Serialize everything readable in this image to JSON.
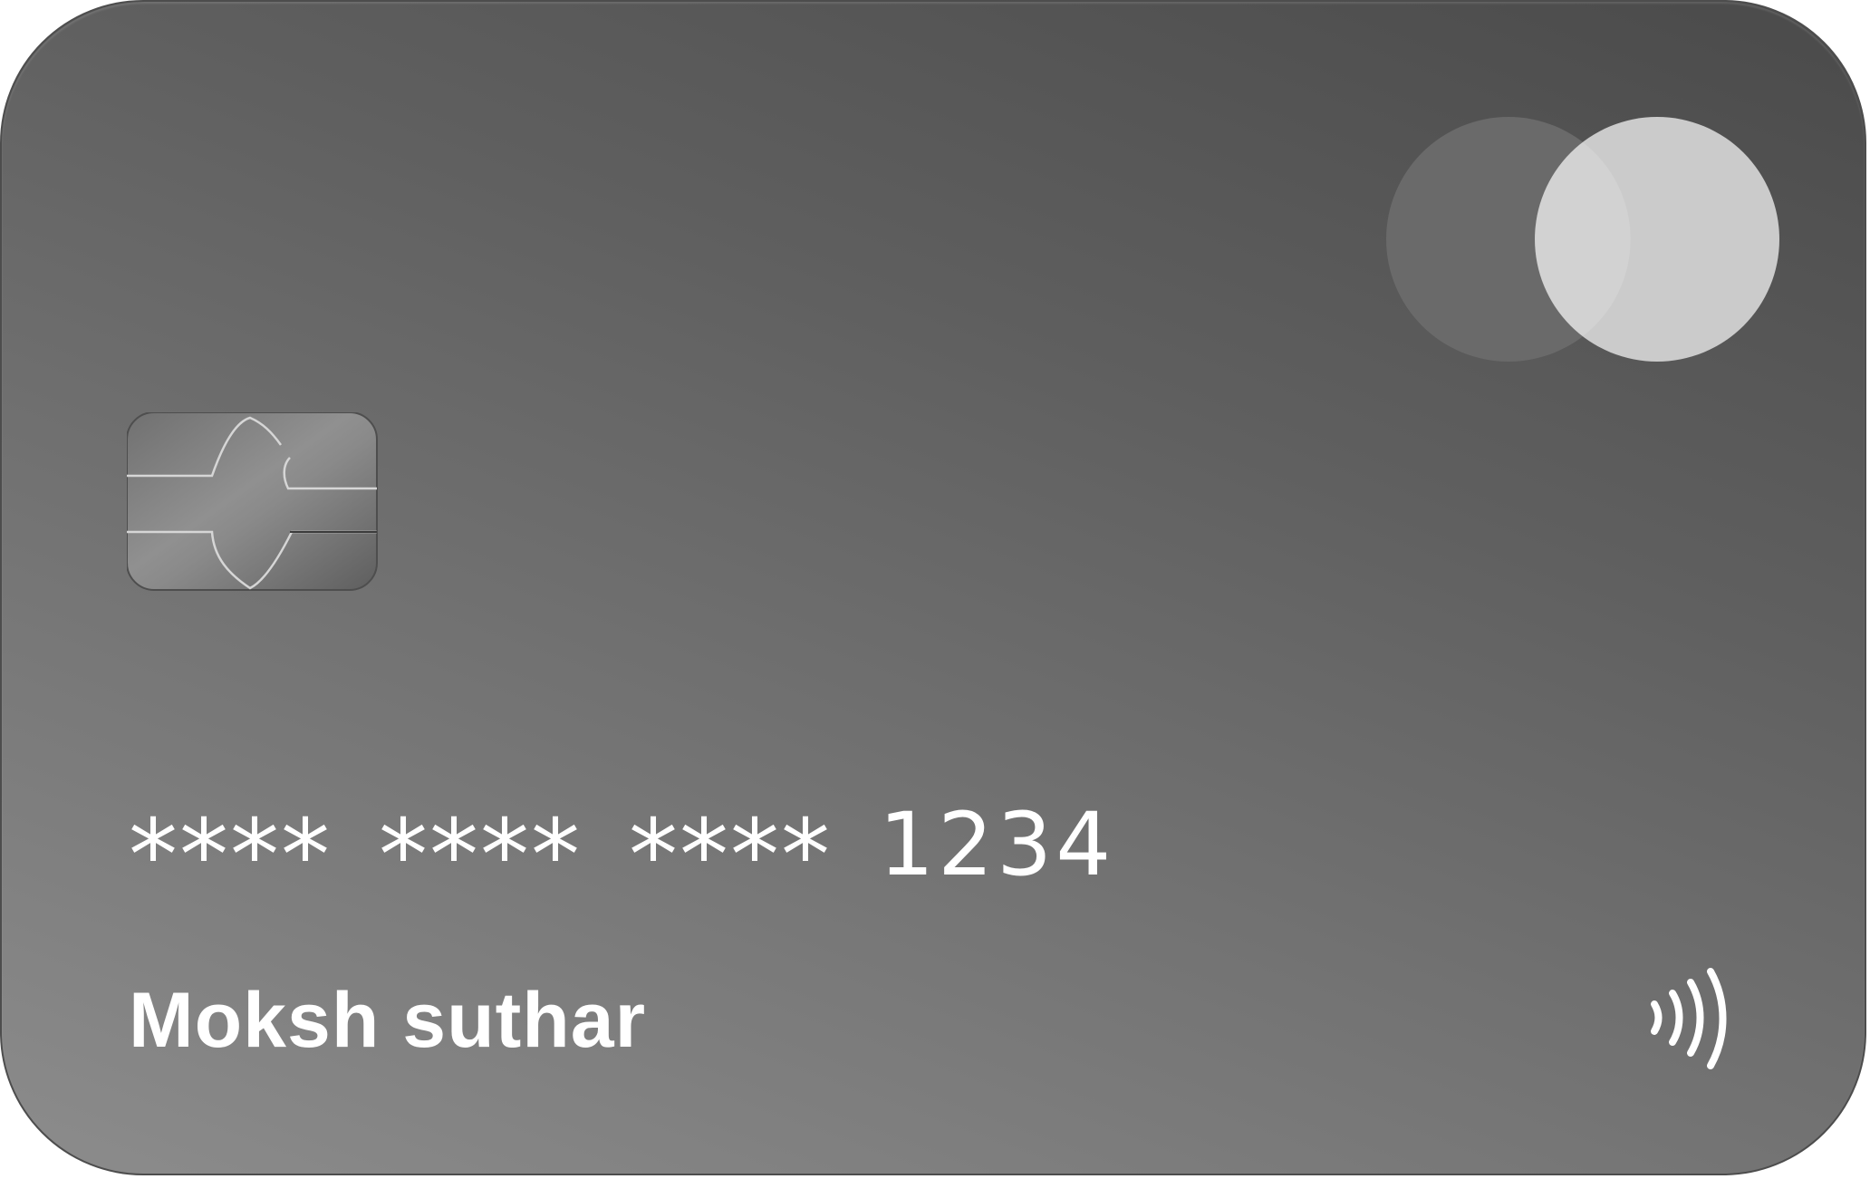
{
  "card": {
    "number_masked_groups": [
      "****",
      "****",
      "****"
    ],
    "number_last4": "1234",
    "holder_name": "Moksh suthar",
    "colors": {
      "background_dark": "#4a4a4a",
      "background_light": "#8c8c8c",
      "text": "#ffffff",
      "logo_left_circle": "#6a6a6a",
      "logo_right_circle": "#cccccc"
    }
  },
  "icons": {
    "brand": "brand-logo-circles-icon",
    "chip": "emv-chip-icon",
    "contactless": "contactless-payment-icon"
  }
}
